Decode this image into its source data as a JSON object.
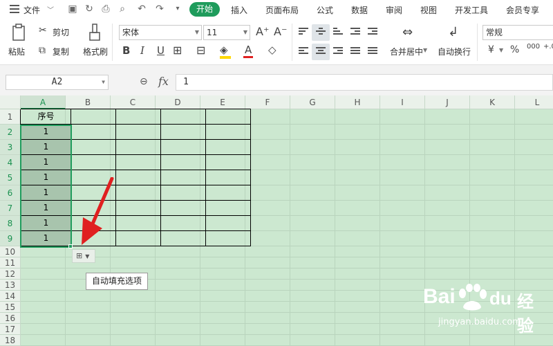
{
  "menubar": {
    "file": "文件",
    "tabs": [
      "插入",
      "页面布局",
      "公式",
      "数据",
      "审阅",
      "视图",
      "开发工具",
      "会员专享"
    ],
    "active_tab": "开始"
  },
  "ribbon": {
    "paste": "粘贴",
    "cut": "剪切",
    "copy": "复制",
    "format_painter": "格式刷",
    "font_name": "宋体",
    "font_size": "11",
    "merge_center": "合并居中",
    "wrap_text": "自动换行",
    "number_format": "常规",
    "percent": "%",
    "currency": "¥"
  },
  "formula_bar": {
    "name_box": "A2",
    "fx_label": "fx",
    "value": "1"
  },
  "grid": {
    "columns": [
      "A",
      "B",
      "C",
      "D",
      "E",
      "F",
      "G",
      "H",
      "I",
      "J",
      "K",
      "L"
    ],
    "rows": [
      "1",
      "2",
      "3",
      "4",
      "5",
      "6",
      "7",
      "8",
      "9",
      "10",
      "11",
      "12",
      "13",
      "14",
      "15",
      "16",
      "17",
      "18"
    ],
    "a1": "序号",
    "a_values": [
      "1",
      "1",
      "1",
      "1",
      "1",
      "1",
      "1",
      "1"
    ]
  },
  "fill_options_tooltip": "自动填充选项",
  "watermark": {
    "brand": "Bai",
    "brand2": "du",
    "cn": "经验",
    "url": "jingyan.baidu.com"
  },
  "colors": {
    "accent": "#1f9c5c",
    "sheet_bg": "#cce8d0",
    "arrow": "#e02020"
  }
}
